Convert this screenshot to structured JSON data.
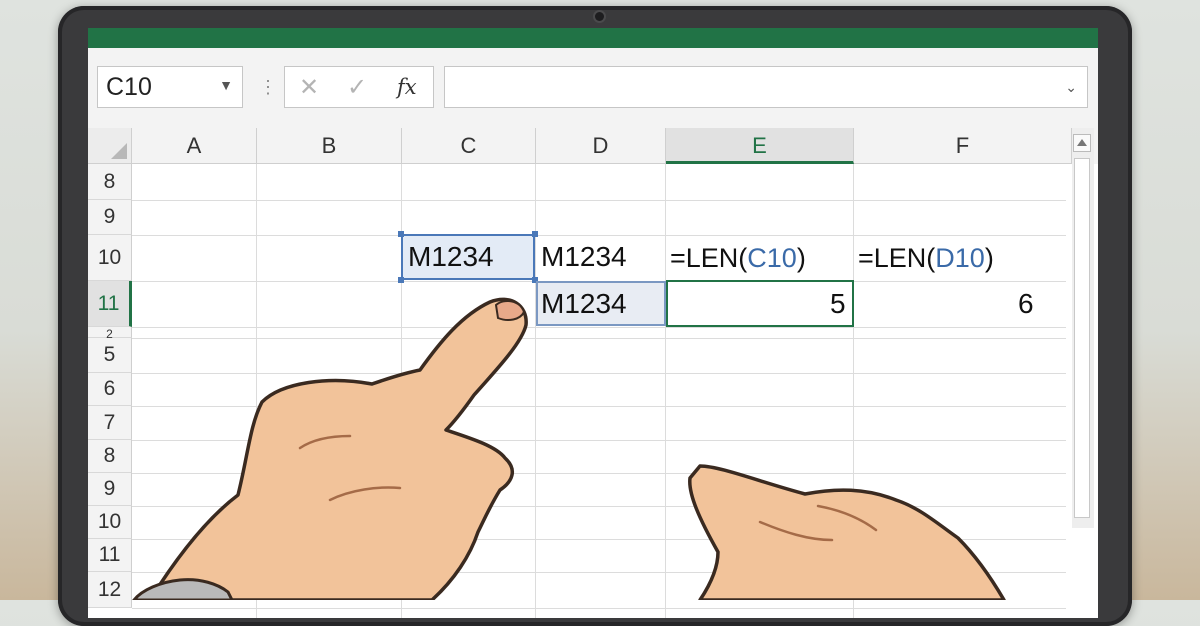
{
  "name_box": {
    "value": "C10"
  },
  "formula_bar": {
    "cancel_glyph": "✕",
    "enter_glyph": "✓",
    "fx_label": "fx",
    "value": ""
  },
  "columns": [
    "A",
    "B",
    "C",
    "D",
    "E",
    "F"
  ],
  "active_column": "E",
  "rows": [
    "8",
    "9",
    "10",
    "11",
    "2",
    "5",
    "6",
    "7",
    "8",
    "9",
    "10",
    "11",
    "12"
  ],
  "active_row": "11",
  "cells": {
    "C10": "M1234",
    "D10": "M1234",
    "E10_prefix": "=LEN(",
    "E10_ref": "C10",
    "E10_suffix": ")",
    "F10_prefix": "=LEN(",
    "F10_ref": "D10",
    "F10_suffix": ")",
    "D11": "M1234",
    "E11": "5",
    "F11": "6"
  },
  "colors": {
    "ribbon": "#217346",
    "ref_text": "#3a6aa8",
    "selection": "#4a78b8"
  },
  "icons": [
    "dropdown-caret-icon",
    "cancel-icon",
    "enter-icon",
    "fx-icon",
    "select-all-icon",
    "scroll-up-icon"
  ]
}
